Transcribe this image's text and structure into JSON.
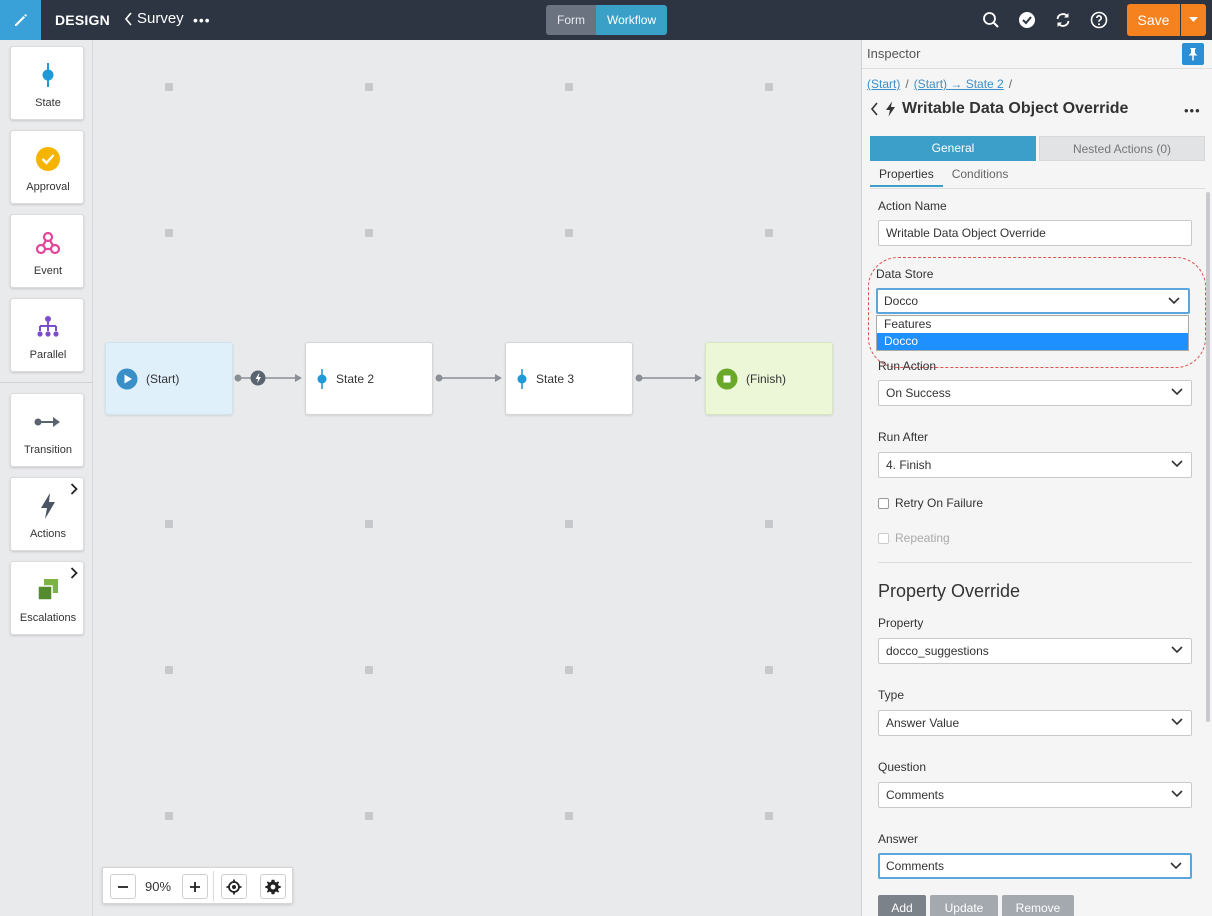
{
  "header": {
    "design_label": "DESIGN",
    "back_label": "Survey",
    "more_label": "•••",
    "mode_form": "Form",
    "mode_workflow": "Workflow",
    "save_label": "Save"
  },
  "toolbox": {
    "items": [
      {
        "label": "State",
        "icon": "state-icon"
      },
      {
        "label": "Approval",
        "icon": "approval-icon"
      },
      {
        "label": "Event",
        "icon": "event-icon"
      },
      {
        "label": "Parallel",
        "icon": "parallel-icon"
      },
      {
        "label": "Transition",
        "icon": "transition-icon"
      },
      {
        "label": "Actions",
        "icon": "actions-icon"
      },
      {
        "label": "Escalations",
        "icon": "escalations-icon"
      }
    ]
  },
  "workflow": {
    "nodes": [
      {
        "label": "(Start)"
      },
      {
        "label": "State 2"
      },
      {
        "label": "State 3"
      },
      {
        "label": "(Finish)"
      }
    ],
    "zoom": "90%"
  },
  "inspector": {
    "title": "Inspector",
    "crumbs": [
      "(Start)",
      "(Start) → State 2"
    ],
    "action_title": "Writable Data Object Override",
    "tab_general": "General",
    "tab_nested": "Nested Actions (0)",
    "subtab_properties": "Properties",
    "subtab_conditions": "Conditions",
    "action_name_label": "Action Name",
    "action_name_value": "Writable Data Object Override",
    "data_store_label": "Data Store",
    "data_store_value": "Docco",
    "data_store_options": [
      "Features",
      "Docco"
    ],
    "run_action_label": "Run Action",
    "run_action_value": "On Success",
    "run_after_label": "Run After",
    "run_after_value": "4. Finish",
    "retry_label": "Retry On Failure",
    "repeating_label": "Repeating",
    "section_title": "Property Override",
    "property_label": "Property",
    "property_value": "docco_suggestions",
    "type_label": "Type",
    "type_value": "Answer Value",
    "question_label": "Question",
    "question_value": "Comments",
    "answer_label": "Answer",
    "answer_value": "Comments",
    "btn_add": "Add",
    "btn_update": "Update",
    "btn_remove": "Remove"
  },
  "colors": {
    "accent": "#3aa0d8",
    "save": "#f5821f",
    "topbar": "#2d3542"
  }
}
